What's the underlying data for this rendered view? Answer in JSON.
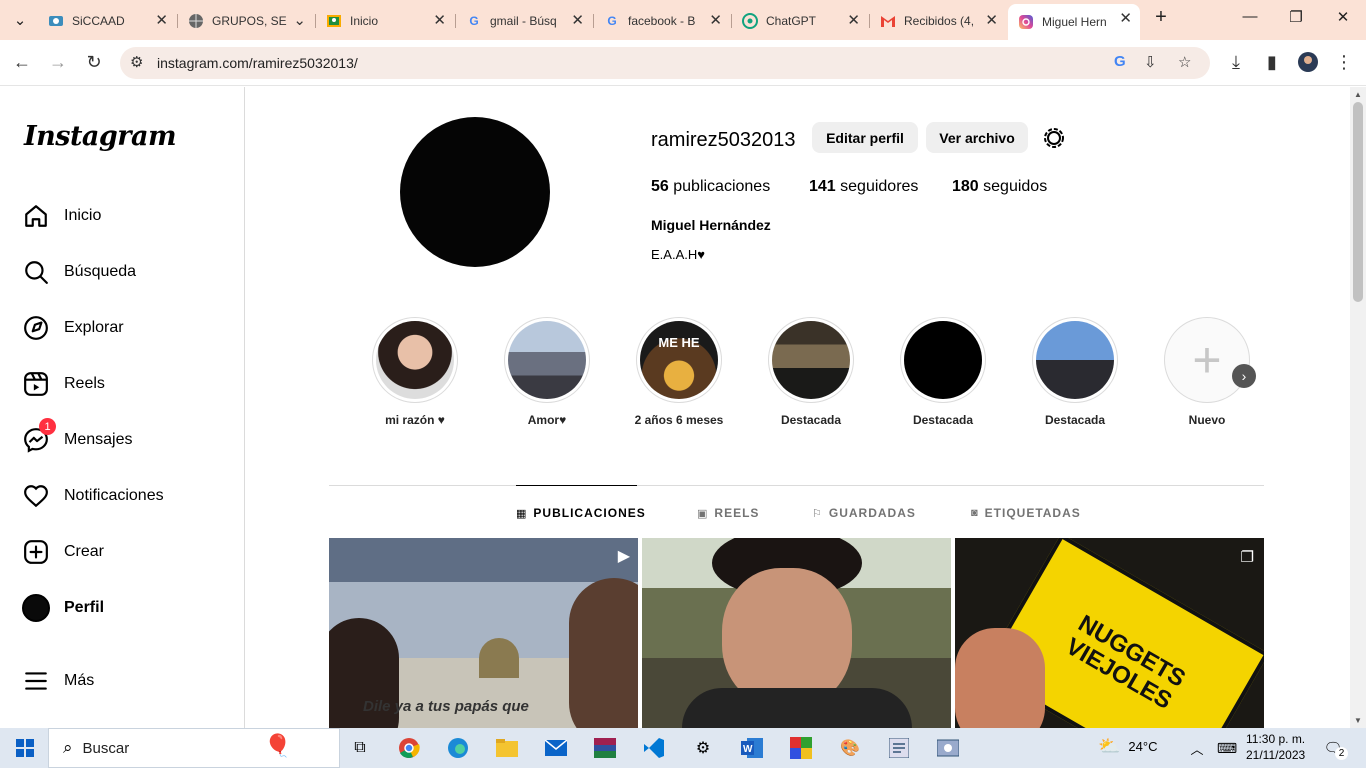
{
  "browser": {
    "tabs": [
      {
        "title": "SiCCAAD",
        "icon": "siccaad-icon",
        "color": "#3c8dbc"
      },
      {
        "title": "GRUPOS, SE",
        "icon": "globe-icon",
        "color": "#555555"
      },
      {
        "title": "Inicio",
        "icon": "classroom-icon",
        "color": "#1e8e3e"
      },
      {
        "title": "gmail - Búsq",
        "icon": "google-icon",
        "color": "#4285f4"
      },
      {
        "title": "facebook - B",
        "icon": "google-icon",
        "color": "#4285f4"
      },
      {
        "title": "ChatGPT",
        "icon": "chatgpt-icon",
        "color": "#10a37f"
      },
      {
        "title": "Recibidos (4,",
        "icon": "gmail-icon",
        "color": "#ea4335"
      },
      {
        "title": "Miguel Hern",
        "icon": "instagram-icon",
        "color": "#d6249f"
      }
    ],
    "url": "instagram.com/ramirez5032013/"
  },
  "sidebar": {
    "logo": "Instagram",
    "items": [
      {
        "label": "Inicio",
        "icon": "home-icon"
      },
      {
        "label": "Búsqueda",
        "icon": "search-icon"
      },
      {
        "label": "Explorar",
        "icon": "compass-icon"
      },
      {
        "label": "Reels",
        "icon": "reels-icon"
      },
      {
        "label": "Mensajes",
        "icon": "messenger-icon",
        "badge": "1"
      },
      {
        "label": "Notificaciones",
        "icon": "heart-icon"
      },
      {
        "label": "Crear",
        "icon": "plus-square-icon"
      },
      {
        "label": "Perfil",
        "icon": "profile-avatar"
      }
    ],
    "more": "Más"
  },
  "profile": {
    "username": "ramirez5032013",
    "edit_button": "Editar perfil",
    "archive_button": "Ver archivo",
    "posts_count": "56",
    "posts_label": "publicaciones",
    "followers_count": "141",
    "followers_label": "seguidores",
    "following_count": "180",
    "following_label": "seguidos",
    "full_name": "Miguel Hernández",
    "bio": "E.A.A.H♥"
  },
  "highlights": [
    {
      "label": "mi razón ♥"
    },
    {
      "label": "Amor♥"
    },
    {
      "label": "2 años 6 meses"
    },
    {
      "label": "Destacada"
    },
    {
      "label": "Destacada"
    },
    {
      "label": "Destacada"
    },
    {
      "label": "Nuevo"
    }
  ],
  "tabs": [
    {
      "label": "PUBLICACIONES",
      "icon": "grid-icon"
    },
    {
      "label": "REELS",
      "icon": "reels-icon"
    },
    {
      "label": "GUARDADAS",
      "icon": "bookmark-icon"
    },
    {
      "label": "ETIQUETADAS",
      "icon": "tag-icon"
    }
  ],
  "posts": [
    {
      "overlay_text": "Dile ya a tus papás que",
      "overlay_icon": "reel-icon"
    },
    {
      "overlay_text": "",
      "overlay_icon": ""
    },
    {
      "overlay_text": "NUGGETS VIEJOLES",
      "overlay_icon": "carousel-icon"
    }
  ],
  "taskbar": {
    "search_placeholder": "Buscar",
    "weather": "24°C",
    "time": "11:30 p. m.",
    "date": "21/11/2023",
    "notifications": "2"
  }
}
